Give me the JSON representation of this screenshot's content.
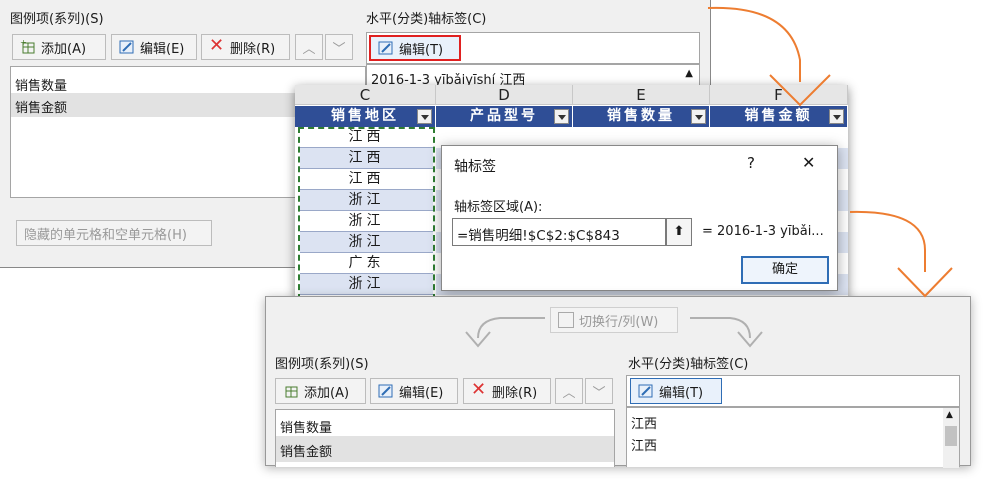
{
  "top_dialog": {
    "legend_title": "图例项(系列)(S)",
    "legend_buttons": {
      "add": "添加(A)",
      "edit": "编辑(E)",
      "delete": "删除(R)"
    },
    "series": [
      "销售数量",
      "销售金额"
    ],
    "hidden_cells_button": "隐藏的单元格和空单元格(H)",
    "axis_title": "水平(分类)轴标签(C)",
    "axis_edit_button": "编辑(T)",
    "axis_first_item": "2016-1-3 yībǎiyīshí 江西"
  },
  "sheet": {
    "columns": [
      "C",
      "D",
      "E",
      "F"
    ],
    "headers": [
      "销售地区",
      "产品型号",
      "销售数量",
      "销售金额"
    ],
    "region_values": [
      "江西",
      "江西",
      "江西",
      "浙江",
      "浙江",
      "浙江",
      "广东",
      "浙江"
    ]
  },
  "axis_dialog": {
    "title": "轴标签",
    "help_symbol": "?",
    "close_symbol": "✕",
    "range_label": "轴标签区域(A):",
    "range_value": "=销售明细!$C$2:$C$843",
    "preview": "= 2016-1-3 yībǎi...",
    "ok_button": "确定"
  },
  "bottom_dialog": {
    "switch_button": "切换行/列(W)",
    "legend_title": "图例项(系列)(S)",
    "legend_buttons": {
      "add": "添加(A)",
      "edit": "编辑(E)",
      "delete": "删除(R)"
    },
    "series": [
      "销售数量",
      "销售金额"
    ],
    "axis_title": "水平(分类)轴标签(C)",
    "axis_edit_button": "编辑(T)",
    "axis_items": [
      "江西",
      "江西"
    ]
  },
  "colors": {
    "accent_orange": "#ed7d31",
    "header_blue": "#2f4e96",
    "highlight_red": "#e02020",
    "selection_gray": "#e2e2e2"
  }
}
